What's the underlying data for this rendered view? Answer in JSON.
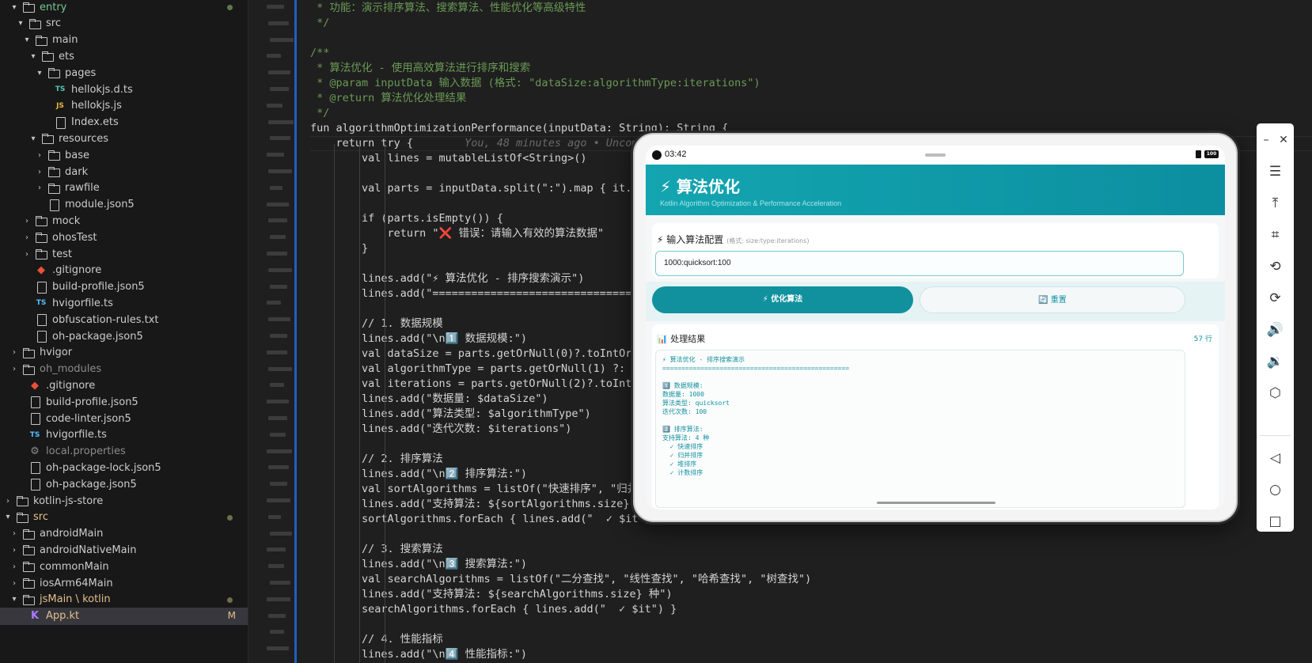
{
  "explorer": {
    "items": [
      {
        "label": "entry",
        "chevron": "▾",
        "icon": "folder",
        "depth": 1,
        "style": "green",
        "dot": "green"
      },
      {
        "label": "src",
        "chevron": "▾",
        "icon": "folder-src",
        "depth": 2,
        "style": ""
      },
      {
        "label": "main",
        "chevron": "▾",
        "icon": "folder",
        "depth": 3,
        "style": ""
      },
      {
        "label": "ets",
        "chevron": "▾",
        "icon": "folder",
        "depth": 4,
        "style": ""
      },
      {
        "label": "pages",
        "chevron": "▾",
        "icon": "folder",
        "depth": 5,
        "style": ""
      },
      {
        "label": "hellokjs.d.ts",
        "chevron": "",
        "icon": "tsd",
        "depth": 6,
        "style": ""
      },
      {
        "label": "hellokjs.js",
        "chevron": "",
        "icon": "js",
        "depth": 6,
        "style": ""
      },
      {
        "label": "Index.ets",
        "chevron": "",
        "icon": "file",
        "depth": 6,
        "style": ""
      },
      {
        "label": "resources",
        "chevron": "▾",
        "icon": "folder",
        "depth": 4,
        "style": ""
      },
      {
        "label": "base",
        "chevron": "›",
        "icon": "folder",
        "depth": 5,
        "style": ""
      },
      {
        "label": "dark",
        "chevron": "›",
        "icon": "folder",
        "depth": 5,
        "style": ""
      },
      {
        "label": "rawfile",
        "chevron": "›",
        "icon": "folder",
        "depth": 5,
        "style": ""
      },
      {
        "label": "module.json5",
        "chevron": "",
        "icon": "file",
        "depth": 5,
        "style": ""
      },
      {
        "label": "mock",
        "chevron": "›",
        "icon": "folder",
        "depth": 3,
        "style": ""
      },
      {
        "label": "ohosTest",
        "chevron": "›",
        "icon": "folder",
        "depth": 3,
        "style": ""
      },
      {
        "label": "test",
        "chevron": "›",
        "icon": "folder-src",
        "depth": 3,
        "style": ""
      },
      {
        "label": ".gitignore",
        "chevron": "",
        "icon": "git",
        "depth": 3,
        "style": ""
      },
      {
        "label": "build-profile.json5",
        "chevron": "",
        "icon": "file",
        "depth": 3,
        "style": ""
      },
      {
        "label": "hvigorfile.ts",
        "chevron": "",
        "icon": "ts",
        "depth": 3,
        "style": ""
      },
      {
        "label": "obfuscation-rules.txt",
        "chevron": "",
        "icon": "file",
        "depth": 3,
        "style": ""
      },
      {
        "label": "oh-package.json5",
        "chevron": "",
        "icon": "file",
        "depth": 3,
        "style": ""
      },
      {
        "label": "hvigor",
        "chevron": "›",
        "icon": "folder",
        "depth": 1,
        "style": ""
      },
      {
        "label": "oh_modules",
        "chevron": "›",
        "icon": "folder",
        "depth": 1,
        "style": "muted"
      },
      {
        "label": ".gitignore",
        "chevron": "",
        "icon": "git",
        "depth": 2,
        "style": ""
      },
      {
        "label": "build-profile.json5",
        "chevron": "",
        "icon": "file",
        "depth": 2,
        "style": ""
      },
      {
        "label": "code-linter.json5",
        "chevron": "",
        "icon": "file",
        "depth": 2,
        "style": ""
      },
      {
        "label": "hvigorfile.ts",
        "chevron": "",
        "icon": "ts",
        "depth": 2,
        "style": ""
      },
      {
        "label": "local.properties",
        "chevron": "",
        "icon": "gear",
        "depth": 2,
        "style": "muted"
      },
      {
        "label": "oh-package-lock.json5",
        "chevron": "",
        "icon": "file",
        "depth": 2,
        "style": ""
      },
      {
        "label": "oh-package.json5",
        "chevron": "",
        "icon": "file",
        "depth": 2,
        "style": ""
      },
      {
        "label": "kotlin-js-store",
        "chevron": "›",
        "icon": "folder",
        "depth": 0,
        "style": ""
      },
      {
        "label": "src",
        "chevron": "▾",
        "icon": "folder",
        "depth": 0,
        "style": "yellow",
        "dot": "yellow"
      },
      {
        "label": "androidMain",
        "chevron": "›",
        "icon": "folder",
        "depth": 1,
        "style": ""
      },
      {
        "label": "androidNativeMain",
        "chevron": "›",
        "icon": "folder",
        "depth": 1,
        "style": ""
      },
      {
        "label": "commonMain",
        "chevron": "›",
        "icon": "folder",
        "depth": 1,
        "style": ""
      },
      {
        "label": "iosArm64Main",
        "chevron": "›",
        "icon": "folder",
        "depth": 1,
        "style": ""
      },
      {
        "label": "jsMain \\ kotlin",
        "chevron": "▾",
        "icon": "folder",
        "depth": 1,
        "style": "yellow",
        "dot": "yellow"
      },
      {
        "label": "App.kt",
        "chevron": "",
        "icon": "kt",
        "depth": 2,
        "style": "yellow",
        "selected": true,
        "badge": "M"
      }
    ]
  },
  "editor": {
    "lines": [
      {
        "text": " * 功能：演示排序算法、搜索算法、性能优化等高级特性",
        "color": "#6a9955"
      },
      {
        "text": " */",
        "color": "#6a9955"
      },
      {
        "text": "",
        "color": "#d4d4d4"
      },
      {
        "text": "/**",
        "color": "#6a9955"
      },
      {
        "text": " * 算法优化 - 使用高效算法进行排序和搜索",
        "color": "#6a9955"
      },
      {
        "text": " * @param inputData 输入数据 (格式: \"dataSize:algorithmType:iterations\")",
        "color": "#6a9955"
      },
      {
        "text": " * @return 算法优化处理结果",
        "color": "#6a9955"
      },
      {
        "text": " */",
        "color": "#6a9955"
      },
      {
        "text": "fun algorithmOptimizationPerformance(inputData: String): String {",
        "color": "#d4d4d4"
      },
      {
        "text": "    return try {",
        "color": "#d4d4d4",
        "ghost": "You, 48 minutes ago • Uncommitted changes"
      },
      {
        "text": "        val lines = mutableListOf<String>()",
        "color": "#d4d4d4"
      },
      {
        "text": "",
        "color": "#d4d4d4"
      },
      {
        "text": "        val parts = inputData.split(\":\").map { it.trim() }",
        "color": "#d4d4d4"
      },
      {
        "text": "",
        "color": "#d4d4d4"
      },
      {
        "text": "        if (parts.isEmpty()) {",
        "color": "#d4d4d4"
      },
      {
        "text": "            return \"❌ 错误：请输入有效的算法数据\"",
        "color": "#d4d4d4"
      },
      {
        "text": "        }",
        "color": "#d4d4d4"
      },
      {
        "text": "",
        "color": "#d4d4d4"
      },
      {
        "text": "        lines.add(\"⚡ 算法优化 - 排序搜索演示\")",
        "color": "#d4d4d4"
      },
      {
        "text": "        lines.add(\"=================================================\")",
        "color": "#d4d4d4"
      },
      {
        "text": "",
        "color": "#d4d4d4"
      },
      {
        "text": "        // 1. 数据规模",
        "color": "#d4d4d4"
      },
      {
        "text": "        lines.add(\"\\n1️⃣ 数据规模:\")",
        "color": "#d4d4d4"
      },
      {
        "text": "        val dataSize = parts.getOrNull(0)?.toIntOrNull() ?: 1000",
        "color": "#d4d4d4"
      },
      {
        "text": "        val algorithmType = parts.getOrNull(1) ?: \"quicksort\"",
        "color": "#d4d4d4"
      },
      {
        "text": "        val iterations = parts.getOrNull(2)?.toIntOrNull() ?: 100",
        "color": "#d4d4d4"
      },
      {
        "text": "        lines.add(\"数据量: $dataSize\")",
        "color": "#d4d4d4"
      },
      {
        "text": "        lines.add(\"算法类型: $algorithmType\")",
        "color": "#d4d4d4"
      },
      {
        "text": "        lines.add(\"迭代次数: $iterations\")",
        "color": "#d4d4d4"
      },
      {
        "text": "",
        "color": "#d4d4d4"
      },
      {
        "text": "        // 2. 排序算法",
        "color": "#d4d4d4"
      },
      {
        "text": "        lines.add(\"\\n2️⃣ 排序算法:\")",
        "color": "#d4d4d4"
      },
      {
        "text": "        val sortAlgorithms = listOf(\"快速排序\", \"归并排序\", \"堆排序\", \"计数排序\")",
        "color": "#d4d4d4"
      },
      {
        "text": "        lines.add(\"支持算法: ${sortAlgorithms.size} 种\")",
        "color": "#d4d4d4"
      },
      {
        "text": "        sortAlgorithms.forEach { lines.add(\"  ✓ $it\") }",
        "color": "#d4d4d4"
      },
      {
        "text": "",
        "color": "#d4d4d4"
      },
      {
        "text": "        // 3. 搜索算法",
        "color": "#d4d4d4"
      },
      {
        "text": "        lines.add(\"\\n3️⃣ 搜索算法:\")",
        "color": "#d4d4d4"
      },
      {
        "text": "        val searchAlgorithms = listOf(\"二分查找\", \"线性查找\", \"哈希查找\", \"树查找\")",
        "color": "#d4d4d4"
      },
      {
        "text": "        lines.add(\"支持算法: ${searchAlgorithms.size} 种\")",
        "color": "#d4d4d4"
      },
      {
        "text": "        searchAlgorithms.forEach { lines.add(\"  ✓ $it\") }",
        "color": "#d4d4d4"
      },
      {
        "text": "",
        "color": "#d4d4d4"
      },
      {
        "text": "        // 4. 性能指标",
        "color": "#d4d4d4"
      },
      {
        "text": "        lines.add(\"\\n4️⃣ 性能指标:\")",
        "color": "#d4d4d4"
      }
    ]
  },
  "emulator": {
    "status_time": "03:42",
    "battery": "100",
    "app_title": "⚡ 算法优化",
    "app_subtitle": "Kotlin Algorithm Optimization & Performance Acceleration",
    "input_title": "⚡ 输入算法配置",
    "input_hint": "(格式: size:type:iterations)",
    "input_value": "1000:quicksort:100",
    "primary_button": "⚡ 优化算法",
    "reset_button": "🔄 重置",
    "result_title": "📊 处理结果",
    "result_count": "57 行",
    "output_lines": [
      "⚡ 算法优化 - 排序搜索演示",
      "=================================================",
      "",
      "1️⃣ 数据规模:",
      "数据量: 1000",
      "算法类型: quicksort",
      "迭代次数: 100",
      "",
      "2️⃣ 排序算法:",
      "支持算法: 4 种",
      "  ✓ 快速排序",
      "  ✓ 归并排序",
      "  ✓ 堆排序",
      "  ✓ 计数排序"
    ]
  },
  "toolbar": {
    "buttons": [
      {
        "name": "minimize-button",
        "glyph": "–"
      },
      {
        "name": "close-button",
        "glyph": "✕"
      },
      {
        "name": "menu-button",
        "glyph": "☰"
      },
      {
        "name": "pin-top-button",
        "glyph": "⤒"
      },
      {
        "name": "screenshot-crop-button",
        "glyph": "⌗"
      },
      {
        "name": "rotate-button",
        "glyph": "⟲"
      },
      {
        "name": "rotate-ccw-button",
        "glyph": "⟳"
      },
      {
        "name": "volume-up-button",
        "glyph": "🔊"
      },
      {
        "name": "volume-down-button",
        "glyph": "🔉"
      },
      {
        "name": "shake-button",
        "glyph": "⬡"
      },
      {
        "name": "back-button",
        "glyph": "◁"
      },
      {
        "name": "home-button",
        "glyph": "○"
      },
      {
        "name": "recents-button",
        "glyph": "□"
      }
    ]
  }
}
